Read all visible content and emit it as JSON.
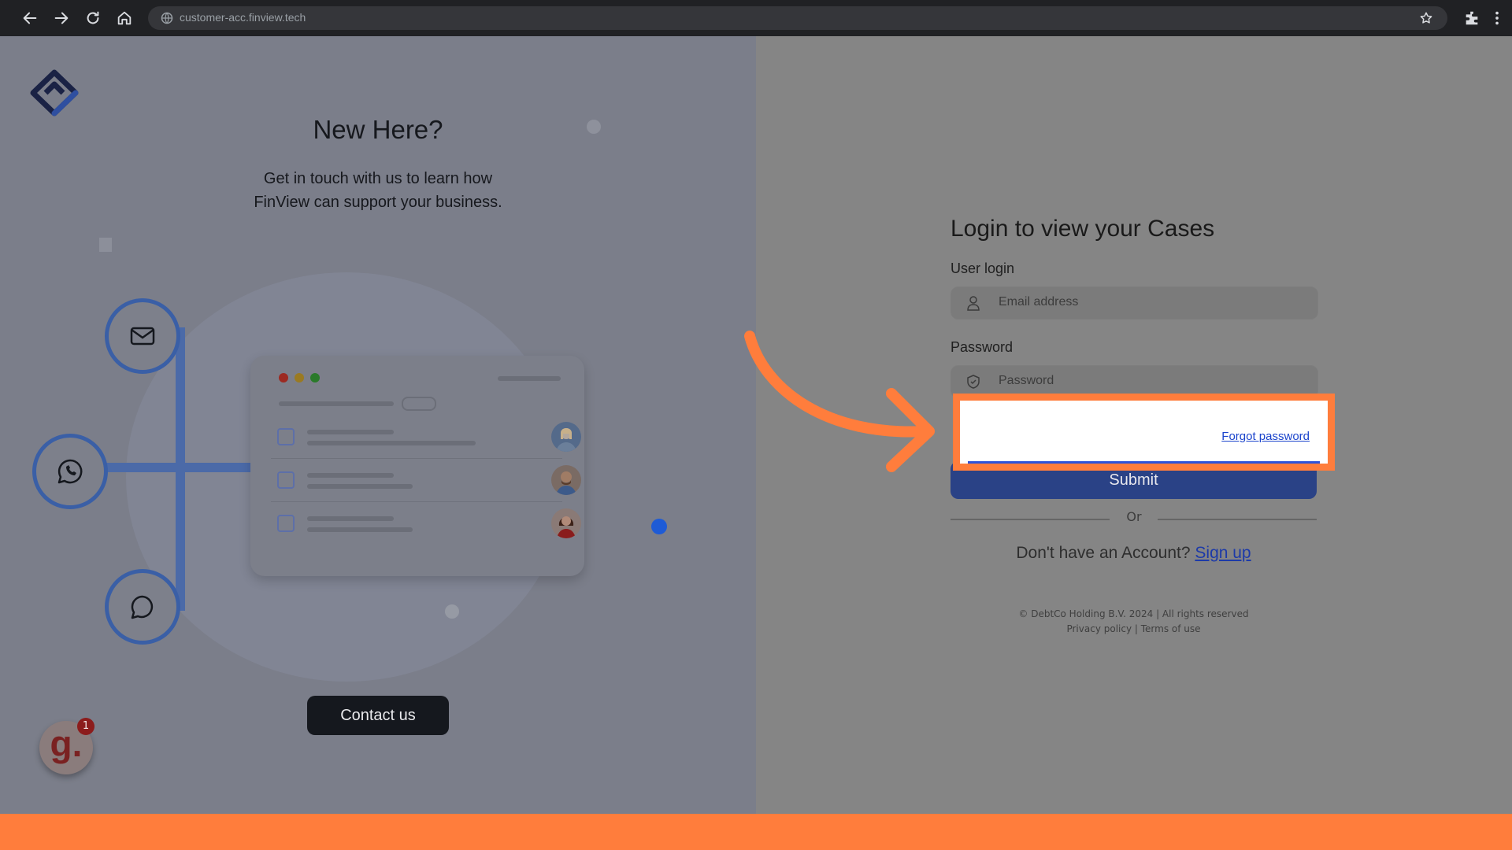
{
  "browser": {
    "url": "customer-acc.finview.tech"
  },
  "left_panel": {
    "title": "New Here?",
    "subtitle_line1": "Get in touch with us to learn how",
    "subtitle_line2": "FinView can support your business.",
    "contact_button": "Contact us",
    "notification_letter": "g.",
    "notification_count": "1"
  },
  "login": {
    "title": "Login to view your Cases",
    "user_label": "User login",
    "email_placeholder": "Email address",
    "password_label": "Password",
    "password_placeholder": "Password",
    "forgot_password": "Forgot password",
    "submit": "Submit",
    "or": "Or",
    "no_account": "Don't have an Account?",
    "signup": "Sign up",
    "copyright": "© DebtCo Holding B.V. 2024 | All rights reserved",
    "privacy": "Privacy policy",
    "terms": "Terms of use"
  },
  "colors": {
    "highlight": "#ff7d3c",
    "brand_blue": "#2a4286"
  }
}
